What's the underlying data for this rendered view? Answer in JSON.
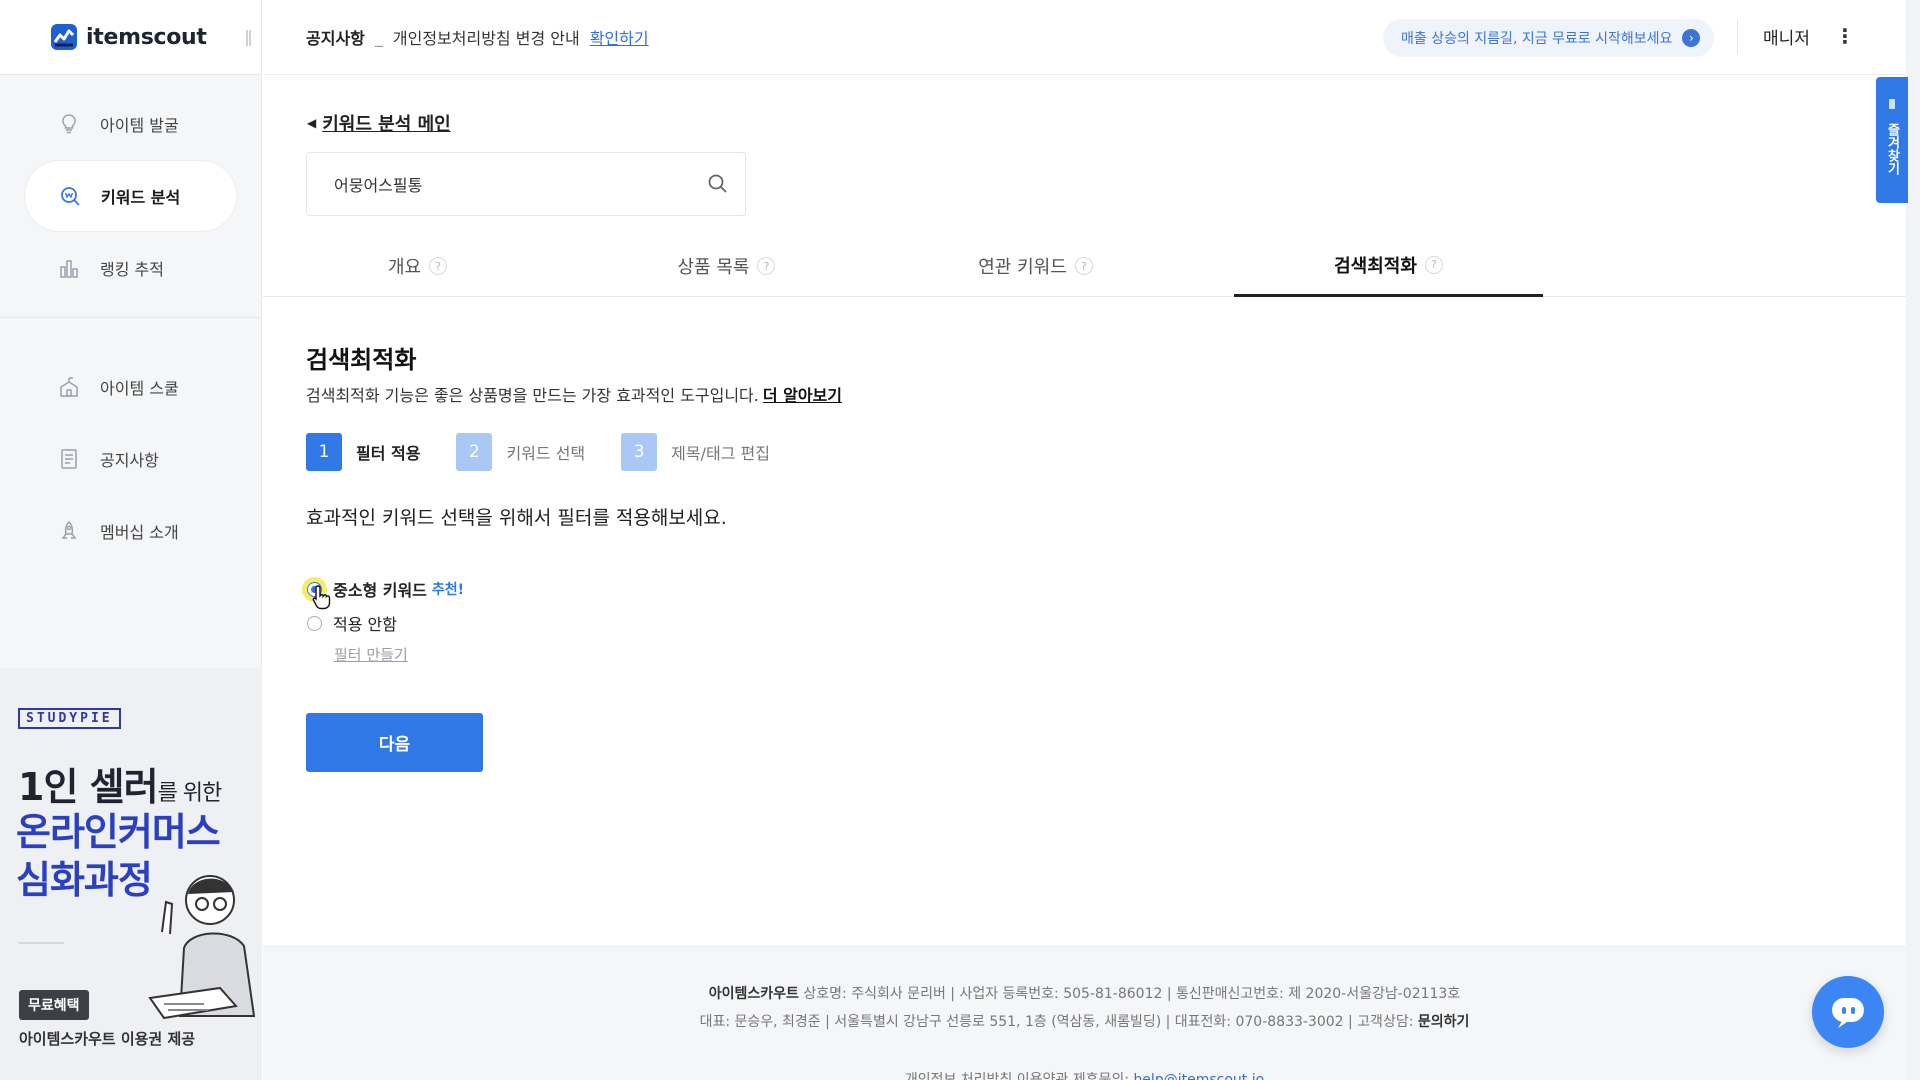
{
  "brand": {
    "name": "itemscout"
  },
  "sidebar": {
    "items": [
      {
        "label": "아이템 발굴",
        "icon": "lightbulb-icon"
      },
      {
        "label": "키워드 분석",
        "icon": "keyword-search-icon",
        "active": true
      },
      {
        "label": "랭킹 추적",
        "icon": "bar-chart-icon"
      }
    ],
    "items2": [
      {
        "label": "아이템 스쿨",
        "icon": "school-icon"
      },
      {
        "label": "공지사항",
        "icon": "notice-icon"
      },
      {
        "label": "멤버십 소개",
        "icon": "rocket-icon"
      }
    ]
  },
  "banner": {
    "brand": "STUDYPIE",
    "line1_big": "1인 셀러",
    "line1_small": "를 위한",
    "line2": "온라인커머스",
    "line3": "심화과정",
    "badge": "무료혜택",
    "foot": "아이템스카우트 이용권 제공"
  },
  "topbar": {
    "notice_tag": "공지사항",
    "notice_sep": "_",
    "notice_text": "개인정보처리방침 변경 안내",
    "notice_link": "확인하기",
    "promo": "매출 상승의 지름길, 지금 무료로 시작해보세요",
    "manager": "매니저",
    "favorite_tab": "즐겨찾기"
  },
  "main": {
    "back_link": "키워드 분석 메인",
    "search": {
      "value": "어뭉어스필통",
      "placeholder": ""
    },
    "tabs": [
      {
        "label": "개요"
      },
      {
        "label": "상품 목록"
      },
      {
        "label": "연관 키워드"
      },
      {
        "label": "검색최적화",
        "active": true
      }
    ],
    "section_title": "검색최적화",
    "section_desc": "검색최적화 기능은 좋은 상품명을 만드는 가장 효과적인 도구입니다.",
    "section_more": "더 알아보기",
    "steps": [
      {
        "num": "1",
        "label": "필터 적용"
      },
      {
        "num": "2",
        "label": "키워드 선택"
      },
      {
        "num": "3",
        "label": "제목/태그 편집"
      }
    ],
    "filter_prompt": "효과적인 키워드 선택을 위해서 필터를 적용해보세요.",
    "option1": "중소형 키워드",
    "option1_tag": "추천!",
    "option2": "적용 안함",
    "make_filter": "필터 만들기",
    "next": "다음"
  },
  "footer": {
    "company": "아이템스카우트",
    "line1": "상호명: 주식회사 문리버 |  사업자 등록번호: 505-81-86012 |  통신판매신고번호: 제 2020-서울강남-02113호",
    "line2": "대표: 문승우, 최경준 |  서울특별시 강남구 선릉로 551, 1층 (역삼동, 새롬빌딩) |  대표전화: 070-8833-3002 |  고객상담:",
    "line2_link": "문의하기",
    "line3": "개인정보 처리방침   이용약관   제휴문의:",
    "line3_email": "help@itemscout.io"
  },
  "colors": {
    "primary": "#2f78e6",
    "step_inactive": "#a9c8f5"
  }
}
